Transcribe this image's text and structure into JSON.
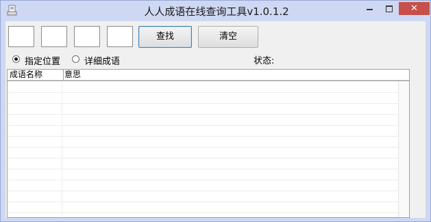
{
  "window": {
    "title": "人人成语在线查询工具v1.0.1.2",
    "icon": "app-icon",
    "controls": {
      "minimize": "minimize-icon",
      "maximize": "maximize-icon",
      "close": "✕"
    }
  },
  "toolbar": {
    "char_inputs": [
      "",
      "",
      "",
      ""
    ],
    "search_label": "查找",
    "clear_label": "清空"
  },
  "options": {
    "radio_position": "指定位置",
    "radio_detail": "详细成语",
    "selected": "指定位置"
  },
  "status": {
    "label": "状态:"
  },
  "results": {
    "columns": [
      "成语名称",
      "意思"
    ],
    "rows": []
  },
  "colors": {
    "frame": "#cfd8f2",
    "client": "#f0f0f0",
    "close": "#c7504a",
    "focus_border": "#3c7fb1"
  }
}
